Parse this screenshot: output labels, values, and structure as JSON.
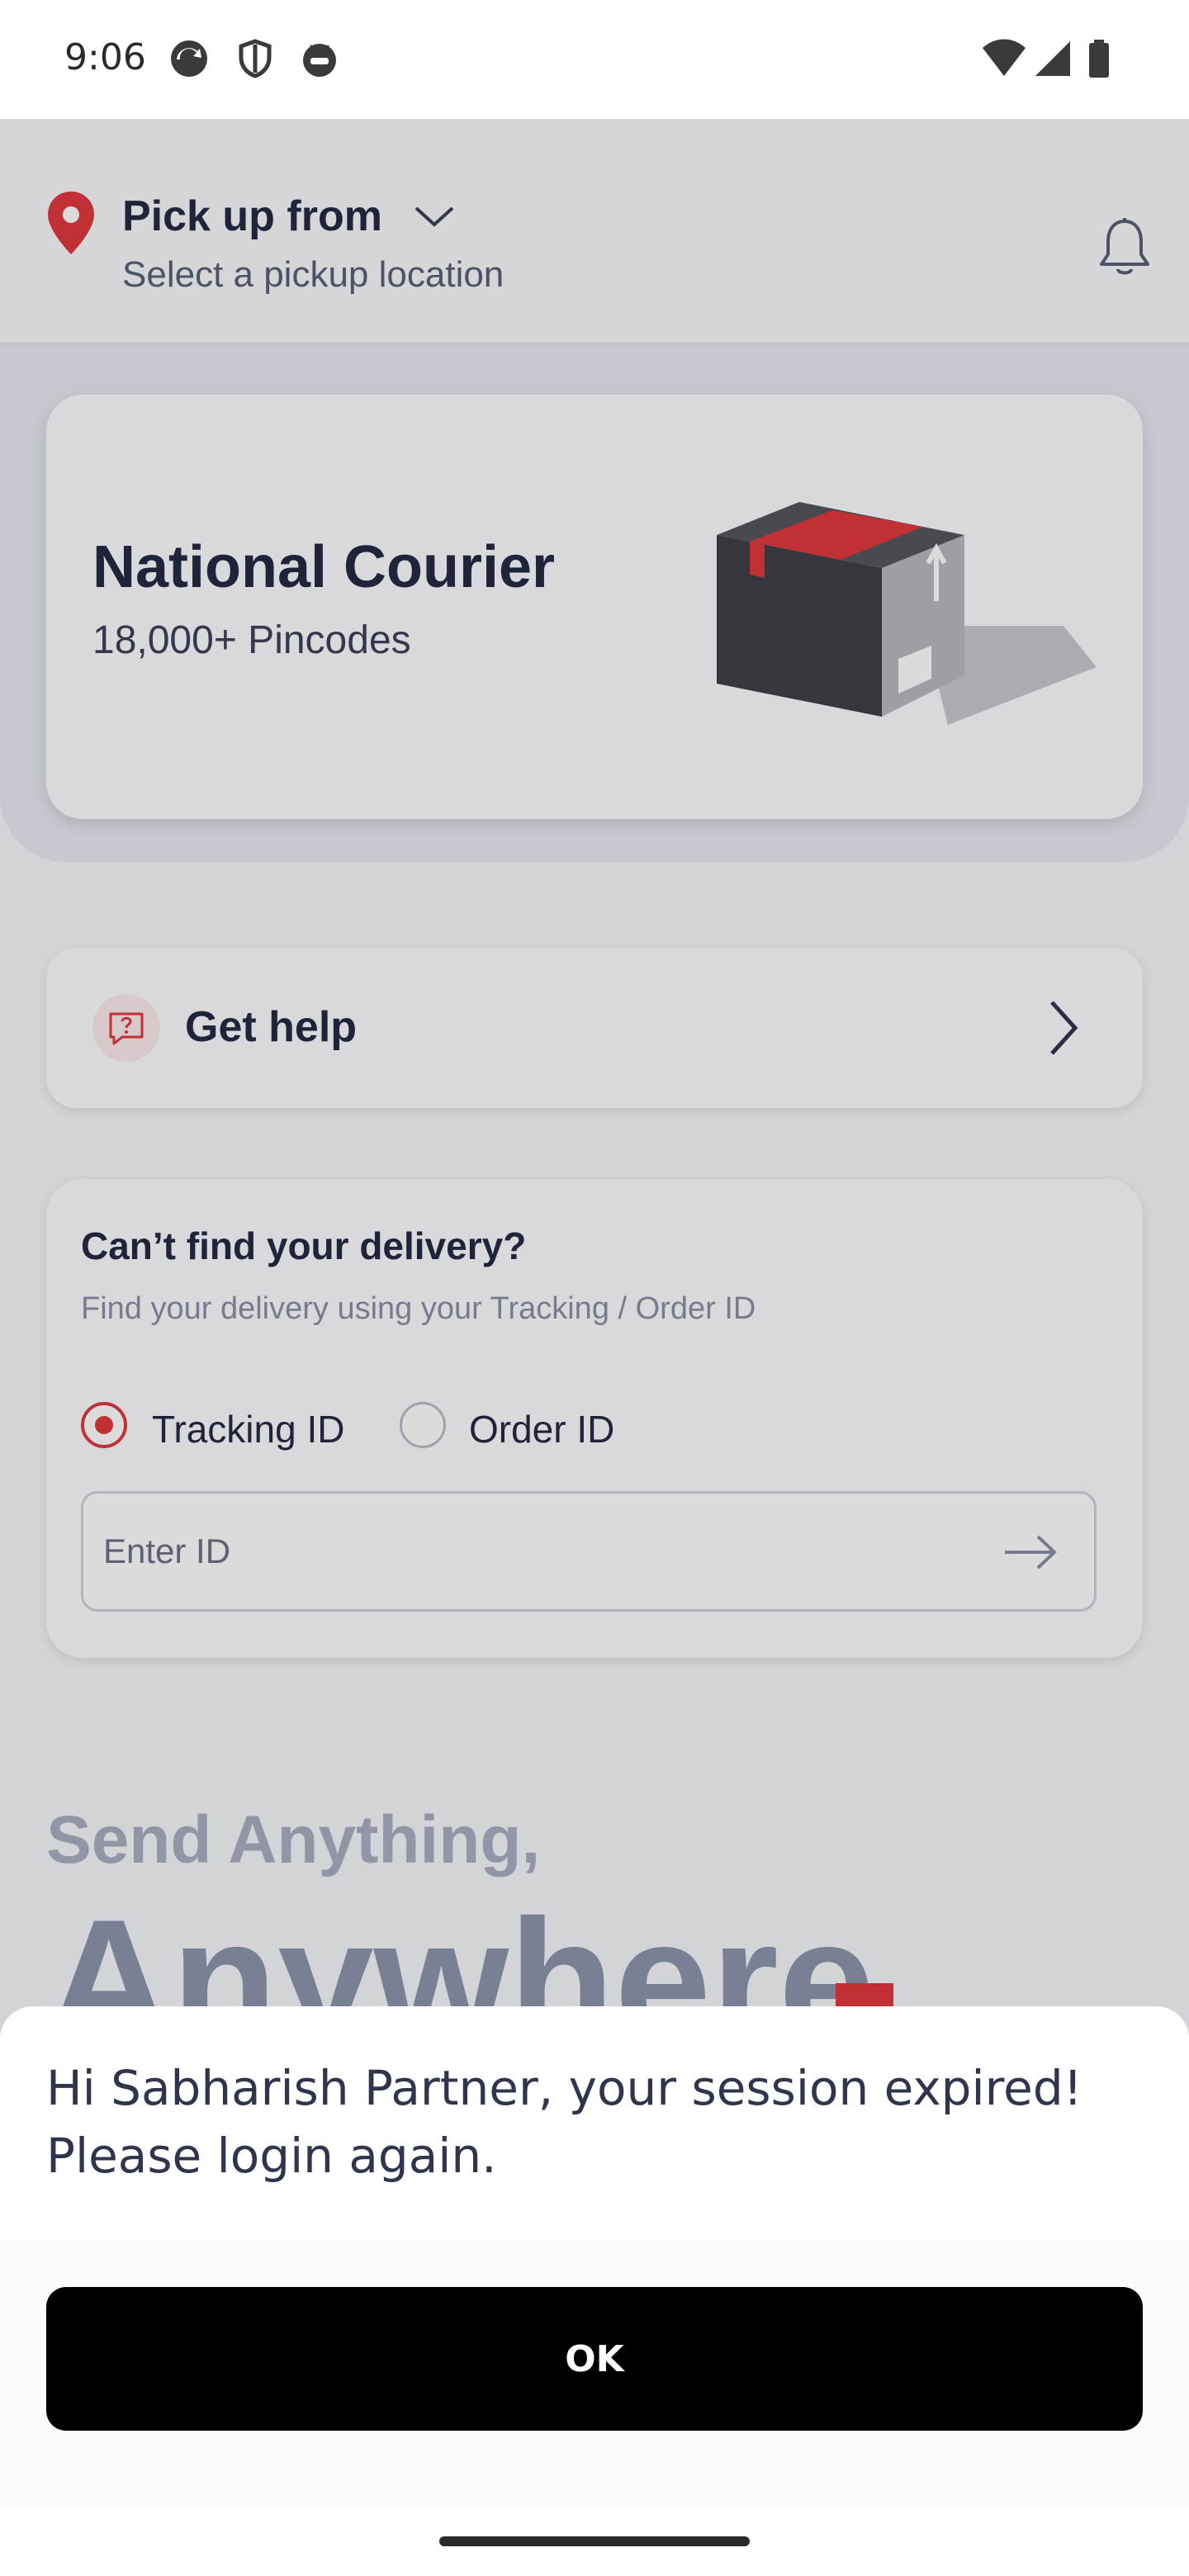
{
  "status_bar": {
    "time": "9:06",
    "left_icons": [
      "sync-app-icon",
      "shield-icon",
      "cat-app-icon"
    ],
    "right_icons": [
      "wifi-icon",
      "cell-signal-icon",
      "battery-icon"
    ]
  },
  "header": {
    "title": "Pick up from",
    "subtitle": "Select a pickup location",
    "accent_color": "#e0383e"
  },
  "courier_card": {
    "title": "National Courier",
    "subtitle": "18,000+ Pincodes"
  },
  "help": {
    "label": "Get help"
  },
  "tracking": {
    "title": "Can’t find your delivery?",
    "subtitle": "Find your delivery using your Tracking / Order ID",
    "options": [
      "Tracking ID",
      "Order ID"
    ],
    "selected": "Tracking ID",
    "input_placeholder": "Enter ID",
    "input_value": ""
  },
  "slogan": {
    "line1": "Send Anything,",
    "line2": "Anywhere"
  },
  "dialog": {
    "message": "Hi Sabharish Partner, your session expired! Please login again.",
    "ok_label": "OK"
  }
}
